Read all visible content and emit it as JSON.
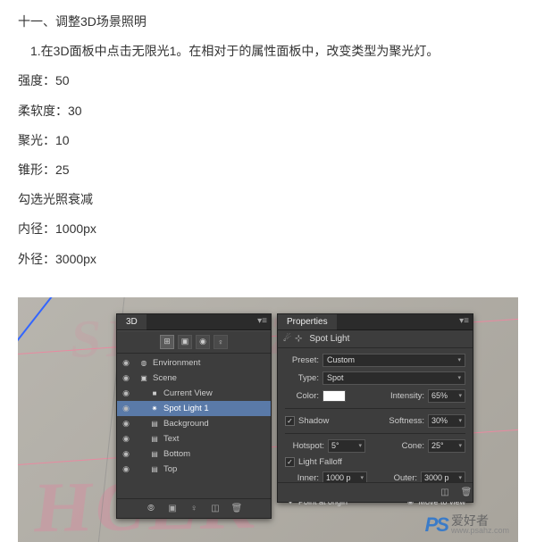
{
  "article": {
    "heading": "十一、调整3D场景照明",
    "step": "　1.在3D面板中点击无限光1。在相对于的属性面板中，改变类型为聚光灯。",
    "params": [
      "强度：50",
      "柔软度：30",
      "聚光：10",
      "锥形：25",
      "勾选光照衰减",
      "内径：1000px",
      "外径：3000px"
    ]
  },
  "panel3d": {
    "title": "3D",
    "items": [
      {
        "label": "Environment",
        "selected": false,
        "indent": 0,
        "icon": "◍"
      },
      {
        "label": "Scene",
        "selected": false,
        "indent": 0,
        "icon": "▣"
      },
      {
        "label": "Current View",
        "selected": false,
        "indent": 1,
        "icon": "■"
      },
      {
        "label": "Spot Light 1",
        "selected": true,
        "indent": 1,
        "icon": "✷"
      },
      {
        "label": "Background",
        "selected": false,
        "indent": 1,
        "icon": "▤"
      },
      {
        "label": "Text",
        "selected": false,
        "indent": 1,
        "icon": "▤"
      },
      {
        "label": "Bottom",
        "selected": false,
        "indent": 1,
        "icon": "▤"
      },
      {
        "label": "Top",
        "selected": false,
        "indent": 1,
        "icon": "▤"
      }
    ]
  },
  "props": {
    "title": "Properties",
    "subtitle": "Spot Light",
    "preset_label": "Preset:",
    "preset_value": "Custom",
    "type_label": "Type:",
    "type_value": "Spot",
    "color_label": "Color:",
    "intensity_label": "Intensity:",
    "intensity_value": "65%",
    "shadow_label": "Shadow",
    "softness_label": "Softness:",
    "softness_value": "30%",
    "hotspot_label": "Hotspot:",
    "hotspot_value": "5°",
    "cone_label": "Cone:",
    "cone_value": "25°",
    "falloff_label": "Light Falloff",
    "inner_label": "Inner:",
    "inner_value": "1000 p",
    "outer_label": "Outer:",
    "outer_value": "3000 p",
    "point_at_origin": "Point at origin",
    "move_to_view": "Move to view"
  },
  "bg": {
    "top_text": "SIHOLZR",
    "bottom_text": "HCEK"
  },
  "watermark": {
    "logo": "PS",
    "cn": "爱好者",
    "url": "www.psahz.com"
  }
}
